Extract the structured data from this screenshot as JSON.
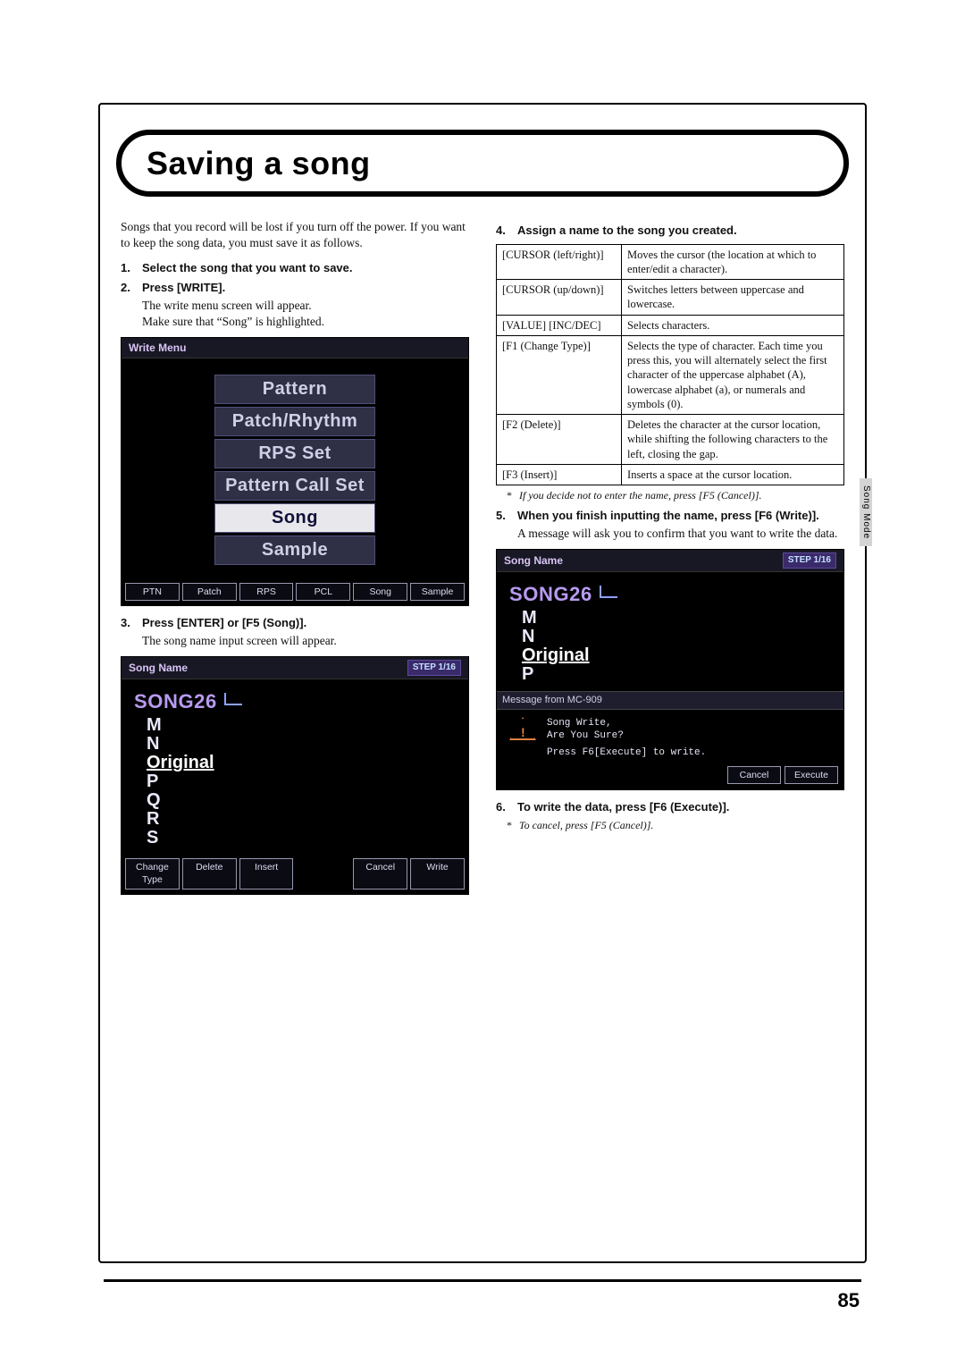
{
  "title": "Saving a song",
  "side_tab": "Song Mode",
  "page_number": "85",
  "intro": "Songs that you record will be lost if you turn off the power. If you want to keep the song data, you must save it as follows.",
  "steps": {
    "s1": {
      "num": "1.",
      "text": "Select the song that you want to save."
    },
    "s2": {
      "num": "2.",
      "text": "Press [WRITE].",
      "sub1": "The write menu screen will appear.",
      "sub2": "Make sure that “Song” is highlighted."
    },
    "s3": {
      "num": "3.",
      "text": "Press [ENTER] or [F5 (Song)].",
      "sub1": "The song name input screen will appear."
    },
    "s4": {
      "num": "4.",
      "text": "Assign a name to the song you created."
    },
    "s5": {
      "num": "5.",
      "text": "When you finish inputting the name, press [F6 (Write)].",
      "sub1": "A message will ask you to confirm that you want to write the data."
    },
    "s6": {
      "num": "6.",
      "text": "To write the data, press [F6 (Execute)]."
    }
  },
  "notes": {
    "cancel_name": "If you decide not to enter the name, press [F5 (Cancel)].",
    "cancel_write": "To cancel, press [F5 (Cancel)]."
  },
  "write_menu": {
    "title": "Write Menu",
    "items": [
      "Pattern",
      "Patch/Rhythm",
      "RPS Set",
      "Pattern Call Set",
      "Song",
      "Sample"
    ],
    "selected": 4,
    "buttons": [
      "PTN",
      "Patch",
      "RPS",
      "PCL",
      "Song",
      "Sample"
    ]
  },
  "song_name": {
    "title": "Song Name",
    "step": "STEP 1/16",
    "current": "SONG26",
    "chars": [
      "M",
      "N",
      "Original",
      "P",
      "Q",
      "R",
      "S"
    ],
    "sel_index": 2,
    "buttons": [
      "Change Type",
      "Delete",
      "Insert",
      "",
      "Cancel",
      "Write"
    ]
  },
  "song_name2": {
    "title": "Song Name",
    "step": "STEP 1/16",
    "current": "SONG26",
    "chars": [
      "M",
      "N",
      "Original",
      "P"
    ],
    "sel_index": 2,
    "msg_bar": "Message from MC-909",
    "confirm_l1": "Song Write,",
    "confirm_l2": "Are You Sure?",
    "confirm_l3": "Press F6[Execute] to write.",
    "buttons": [
      "Cancel",
      "Execute"
    ]
  },
  "table": [
    {
      "k": "[CURSOR (left/right)]",
      "v": "Moves the cursor (the location at which to enter/edit a character)."
    },
    {
      "k": "[CURSOR (up/down)]",
      "v": "Switches letters between uppercase and lowercase."
    },
    {
      "k": "[VALUE] [INC/DEC]",
      "v": "Selects characters."
    },
    {
      "k": "[F1 (Change Type)]",
      "v": "Selects the type of character.\nEach time you press this, you will alternately select the first character of the uppercase alphabet (A), lowercase alphabet (a), or numerals and symbols (0)."
    },
    {
      "k": "[F2 (Delete)]",
      "v": "Deletes the character at the cursor location, while shifting the following characters to the left, closing the gap."
    },
    {
      "k": "[F3 (Insert)]",
      "v": "Inserts a space at the cursor location."
    }
  ]
}
